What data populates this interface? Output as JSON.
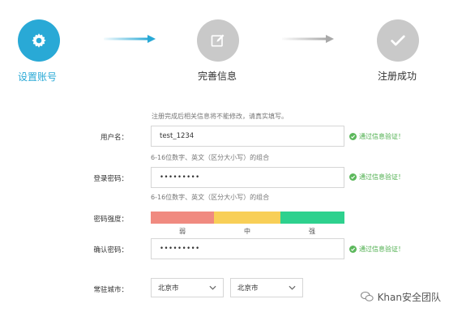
{
  "steps": [
    {
      "label": "设置账号",
      "state": "active",
      "icon": "gear-icon"
    },
    {
      "label": "完善信息",
      "state": "pending",
      "icon": "edit-icon"
    },
    {
      "label": "注册成功",
      "state": "pending",
      "icon": "check-icon"
    }
  ],
  "colors": {
    "active": "#29a9d6",
    "pending": "#c9c9c9",
    "success": "#4cae4c",
    "weak": "#f08a80",
    "medium": "#f8cf57",
    "strong": "#2ed18e"
  },
  "form": {
    "notice": "注册完成后相关信息将不能修改，请真实填写。",
    "username": {
      "label": "用户名：",
      "value": "test_1234",
      "hint": "6-16位数字、英文（区分大小写）的组合",
      "status": "通过信息验证！"
    },
    "password": {
      "label": "登录密码：",
      "value": "•••••••••",
      "hint": "6-16位数字、英文（区分大小写）的组合",
      "status": "通过信息验证！"
    },
    "strength": {
      "label": "密码强度：",
      "weak": "弱",
      "medium": "中",
      "strong": "强"
    },
    "confirm": {
      "label": "确认密码：",
      "value": "•••••••••",
      "status": "通过信息验证！"
    },
    "city": {
      "label": "常驻城市：",
      "province": "北京市",
      "city": "北京市"
    }
  },
  "watermark": "Khan安全团队"
}
